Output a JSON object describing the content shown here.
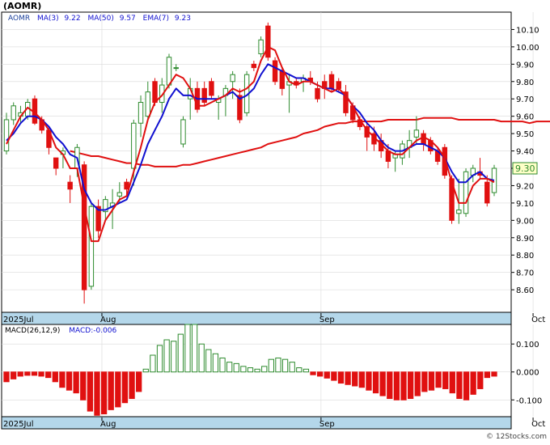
{
  "title": "(AOMR)",
  "legend": {
    "symbol": "AOMR",
    "ma3_label": "MA(3)",
    "ma3_value": "9.22",
    "ma50_label": "MA(50)",
    "ma50_value": "9.57",
    "ema7_label": "EMA(7)",
    "ema7_value": "9.23"
  },
  "macd_legend": {
    "label": "MACD(26,12,9)",
    "value_label": "MACD:-0.006"
  },
  "last_price_label": "9.30",
  "watermark": "© 12Stocks.com",
  "colors": {
    "up": "#2e8b2e",
    "down": "#e01010",
    "ma": "#1010d0",
    "ema": "#e01010",
    "axis_band": "#b4d7ea",
    "grid": "#d9d9d9"
  },
  "chart_data": [
    {
      "type": "candlestick",
      "y_axis": {
        "min": 8.47,
        "max": 10.2,
        "ticks": [
          "8.60",
          "8.70",
          "8.80",
          "8.90",
          "9.00",
          "9.10",
          "9.20",
          "9.30",
          "9.40",
          "9.50",
          "9.60",
          "9.70",
          "9.80",
          "9.90",
          "10.00",
          "10.10"
        ]
      },
      "x_labels": [
        "2025Jul",
        "Aug",
        "Sep",
        "Oct"
      ],
      "x_label_index": [
        0,
        14,
        45,
        75
      ],
      "grid": true,
      "candles": [
        {
          "o": 9.4,
          "h": 9.62,
          "l": 9.38,
          "c": 9.58
        },
        {
          "o": 9.58,
          "h": 9.68,
          "l": 9.55,
          "c": 9.66
        },
        {
          "o": 9.6,
          "h": 9.66,
          "l": 9.56,
          "c": 9.62
        },
        {
          "o": 9.6,
          "h": 9.7,
          "l": 9.58,
          "c": 9.68
        },
        {
          "o": 9.7,
          "h": 9.72,
          "l": 9.55,
          "c": 9.56
        },
        {
          "o": 9.58,
          "h": 9.6,
          "l": 9.5,
          "c": 9.52
        },
        {
          "o": 9.52,
          "h": 9.54,
          "l": 9.38,
          "c": 9.42
        },
        {
          "o": 9.36,
          "h": 9.36,
          "l": 9.26,
          "c": 9.3
        },
        {
          "o": 9.38,
          "h": 9.42,
          "l": 9.3,
          "c": 9.4
        },
        {
          "o": 9.22,
          "h": 9.26,
          "l": 9.1,
          "c": 9.18
        },
        {
          "o": 9.3,
          "h": 9.44,
          "l": 9.25,
          "c": 9.42
        },
        {
          "o": 9.32,
          "h": 9.34,
          "l": 8.52,
          "c": 8.6
        },
        {
          "o": 8.62,
          "h": 9.1,
          "l": 8.6,
          "c": 9.08
        },
        {
          "o": 9.08,
          "h": 9.12,
          "l": 8.9,
          "c": 8.94
        },
        {
          "o": 9.05,
          "h": 9.14,
          "l": 9.0,
          "c": 9.12
        },
        {
          "o": 9.08,
          "h": 9.18,
          "l": 8.95,
          "c": 9.1
        },
        {
          "o": 9.14,
          "h": 9.22,
          "l": 9.1,
          "c": 9.16
        },
        {
          "o": 9.22,
          "h": 9.24,
          "l": 9.14,
          "c": 9.18
        },
        {
          "o": 9.3,
          "h": 9.58,
          "l": 9.2,
          "c": 9.56
        },
        {
          "o": 9.56,
          "h": 9.72,
          "l": 9.48,
          "c": 9.68
        },
        {
          "o": 9.6,
          "h": 9.8,
          "l": 9.58,
          "c": 9.74
        },
        {
          "o": 9.8,
          "h": 9.82,
          "l": 9.66,
          "c": 9.68
        },
        {
          "o": 9.68,
          "h": 9.82,
          "l": 9.62,
          "c": 9.78
        },
        {
          "o": 9.78,
          "h": 9.96,
          "l": 9.76,
          "c": 9.94
        },
        {
          "o": 9.88,
          "h": 9.9,
          "l": 9.86,
          "c": 9.88
        },
        {
          "o": 9.44,
          "h": 9.6,
          "l": 9.42,
          "c": 9.58
        },
        {
          "o": 9.7,
          "h": 9.82,
          "l": 9.58,
          "c": 9.76
        },
        {
          "o": 9.76,
          "h": 9.8,
          "l": 9.62,
          "c": 9.64
        },
        {
          "o": 9.76,
          "h": 9.8,
          "l": 9.66,
          "c": 9.68
        },
        {
          "o": 9.8,
          "h": 9.82,
          "l": 9.7,
          "c": 9.72
        },
        {
          "o": 9.68,
          "h": 9.72,
          "l": 9.58,
          "c": 9.7
        },
        {
          "o": 9.72,
          "h": 9.78,
          "l": 9.6,
          "c": 9.76
        },
        {
          "o": 9.8,
          "h": 9.86,
          "l": 9.7,
          "c": 9.84
        },
        {
          "o": 9.72,
          "h": 9.76,
          "l": 9.56,
          "c": 9.58
        },
        {
          "o": 9.62,
          "h": 9.86,
          "l": 9.6,
          "c": 9.84
        },
        {
          "o": 9.9,
          "h": 9.92,
          "l": 9.86,
          "c": 9.88
        },
        {
          "o": 9.96,
          "h": 10.06,
          "l": 9.94,
          "c": 10.04
        },
        {
          "o": 10.12,
          "h": 10.14,
          "l": 9.92,
          "c": 9.94
        },
        {
          "o": 9.92,
          "h": 9.94,
          "l": 9.78,
          "c": 9.8
        },
        {
          "o": 9.86,
          "h": 9.88,
          "l": 9.72,
          "c": 9.76
        },
        {
          "o": 9.78,
          "h": 9.84,
          "l": 9.62,
          "c": 9.8
        },
        {
          "o": 9.8,
          "h": 9.82,
          "l": 9.76,
          "c": 9.78
        },
        {
          "o": 9.8,
          "h": 9.84,
          "l": 9.74,
          "c": 9.82
        },
        {
          "o": 9.82,
          "h": 9.86,
          "l": 9.78,
          "c": 9.8
        },
        {
          "o": 9.76,
          "h": 9.8,
          "l": 9.68,
          "c": 9.7
        },
        {
          "o": 9.8,
          "h": 9.84,
          "l": 9.7,
          "c": 9.76
        },
        {
          "o": 9.84,
          "h": 9.86,
          "l": 9.74,
          "c": 9.76
        },
        {
          "o": 9.8,
          "h": 9.82,
          "l": 9.74,
          "c": 9.76
        },
        {
          "o": 9.74,
          "h": 9.78,
          "l": 9.6,
          "c": 9.62
        },
        {
          "o": 9.66,
          "h": 9.68,
          "l": 9.56,
          "c": 9.58
        },
        {
          "o": 9.58,
          "h": 9.6,
          "l": 9.52,
          "c": 9.54
        },
        {
          "o": 9.54,
          "h": 9.56,
          "l": 9.4,
          "c": 9.48
        },
        {
          "o": 9.5,
          "h": 9.54,
          "l": 9.4,
          "c": 9.44
        },
        {
          "o": 9.46,
          "h": 9.5,
          "l": 9.36,
          "c": 9.4
        },
        {
          "o": 9.4,
          "h": 9.44,
          "l": 9.3,
          "c": 9.34
        },
        {
          "o": 9.36,
          "h": 9.4,
          "l": 9.28,
          "c": 9.38
        },
        {
          "o": 9.36,
          "h": 9.46,
          "l": 9.32,
          "c": 9.44
        },
        {
          "o": 9.42,
          "h": 9.52,
          "l": 9.36,
          "c": 9.46
        },
        {
          "o": 9.48,
          "h": 9.6,
          "l": 9.44,
          "c": 9.52
        },
        {
          "o": 9.5,
          "h": 9.52,
          "l": 9.4,
          "c": 9.44
        },
        {
          "o": 9.46,
          "h": 9.48,
          "l": 9.38,
          "c": 9.4
        },
        {
          "o": 9.4,
          "h": 9.42,
          "l": 9.32,
          "c": 9.34
        },
        {
          "o": 9.42,
          "h": 9.44,
          "l": 9.24,
          "c": 9.26
        },
        {
          "o": 9.24,
          "h": 9.26,
          "l": 8.98,
          "c": 9.0
        },
        {
          "o": 9.04,
          "h": 9.24,
          "l": 8.98,
          "c": 9.06
        },
        {
          "o": 9.04,
          "h": 9.3,
          "l": 9.02,
          "c": 9.28
        },
        {
          "o": 9.26,
          "h": 9.32,
          "l": 9.22,
          "c": 9.3
        },
        {
          "o": 9.28,
          "h": 9.36,
          "l": 9.24,
          "c": 9.26
        },
        {
          "o": 9.22,
          "h": 9.26,
          "l": 9.08,
          "c": 9.1
        },
        {
          "o": 9.16,
          "h": 9.32,
          "l": 9.14,
          "c": 9.3
        }
      ],
      "ma3": [
        9.44,
        9.52,
        9.6,
        9.65,
        9.62,
        9.58,
        9.52,
        9.42,
        9.38,
        9.3,
        9.3,
        9.08,
        8.88,
        8.88,
        9.0,
        9.06,
        9.12,
        9.14,
        9.28,
        9.42,
        9.58,
        9.68,
        9.72,
        9.78,
        9.84,
        9.82,
        9.76,
        9.66,
        9.66,
        9.68,
        9.7,
        9.72,
        9.76,
        9.74,
        9.76,
        9.8,
        9.92,
        10.0,
        9.98,
        9.88,
        9.8,
        9.78,
        9.8,
        9.8,
        9.78,
        9.76,
        9.74,
        9.76,
        9.72,
        9.66,
        9.58,
        9.52,
        9.48,
        9.44,
        9.4,
        9.38,
        9.38,
        9.42,
        9.46,
        9.48,
        9.46,
        9.42,
        9.36,
        9.22,
        9.1,
        9.1,
        9.2,
        9.24,
        9.24,
        9.22
      ],
      "ema7": [
        9.46,
        9.5,
        9.56,
        9.6,
        9.6,
        9.58,
        9.54,
        9.48,
        9.44,
        9.38,
        9.36,
        9.18,
        9.1,
        9.06,
        9.06,
        9.08,
        9.1,
        9.12,
        9.22,
        9.32,
        9.44,
        9.52,
        9.6,
        9.7,
        9.76,
        9.72,
        9.72,
        9.7,
        9.7,
        9.7,
        9.7,
        9.72,
        9.74,
        9.7,
        9.72,
        9.76,
        9.84,
        9.9,
        9.88,
        9.86,
        9.84,
        9.82,
        9.82,
        9.8,
        9.78,
        9.76,
        9.76,
        9.74,
        9.72,
        9.66,
        9.62,
        9.56,
        9.52,
        9.46,
        9.42,
        9.4,
        9.4,
        9.42,
        9.44,
        9.44,
        9.42,
        9.4,
        9.36,
        9.28,
        9.22,
        9.22,
        9.26,
        9.28,
        9.24,
        9.23
      ],
      "ma50": [
        9.4,
        9.39,
        9.38,
        9.37,
        9.37,
        9.36,
        9.35,
        9.34,
        9.33,
        9.33,
        9.32,
        9.32,
        9.31,
        9.31,
        9.31,
        9.31,
        9.32,
        9.32,
        9.33,
        9.34,
        9.35,
        9.36,
        9.37,
        9.38,
        9.39,
        9.4,
        9.41,
        9.42,
        9.44,
        9.45,
        9.46,
        9.47,
        9.48,
        9.5,
        9.51,
        9.52,
        9.54,
        9.55,
        9.56,
        9.56,
        9.57,
        9.57,
        9.57,
        9.57,
        9.57,
        9.58,
        9.58,
        9.58,
        9.58,
        9.58,
        9.59,
        9.59,
        9.59,
        9.59,
        9.59,
        9.58,
        9.58,
        9.58,
        9.58,
        9.58,
        9.58,
        9.57,
        9.57,
        9.57,
        9.57,
        9.56,
        9.57,
        9.57,
        9.57,
        9.57
      ],
      "ma_start_index": 0,
      "ema_start_index": 0,
      "ma50_start_index": 9
    },
    {
      "type": "bar",
      "name": "MACD(26,12,9)",
      "y_axis": {
        "min": -0.16,
        "max": 0.17,
        "ticks": [
          "0.100",
          "0.000",
          "-0.100"
        ],
        "tick_values": [
          0.1,
          0.0,
          -0.1
        ]
      },
      "x_labels": [
        "2025Jul",
        "Aug",
        "Sep",
        "Oct"
      ],
      "x_label_index": [
        0,
        14,
        45,
        75
      ],
      "values": [
        -0.035,
        -0.025,
        -0.015,
        -0.012,
        -0.012,
        -0.015,
        -0.02,
        -0.035,
        -0.055,
        -0.065,
        -0.075,
        -0.1,
        -0.14,
        -0.155,
        -0.15,
        -0.135,
        -0.125,
        -0.11,
        -0.095,
        -0.07,
        0.01,
        0.06,
        0.095,
        0.115,
        0.11,
        0.135,
        0.17,
        0.17,
        0.1,
        0.08,
        0.065,
        0.05,
        0.035,
        0.03,
        0.02,
        0.015,
        0.01,
        0.02,
        0.045,
        0.05,
        0.045,
        0.035,
        0.015,
        0.01,
        -0.01,
        -0.015,
        -0.022,
        -0.03,
        -0.04,
        -0.045,
        -0.05,
        -0.055,
        -0.065,
        -0.075,
        -0.085,
        -0.095,
        -0.1,
        -0.1,
        -0.095,
        -0.085,
        -0.07,
        -0.065,
        -0.055,
        -0.06,
        -0.075,
        -0.095,
        -0.1,
        -0.08,
        -0.06,
        -0.02,
        -0.015
      ],
      "grid": true
    }
  ]
}
